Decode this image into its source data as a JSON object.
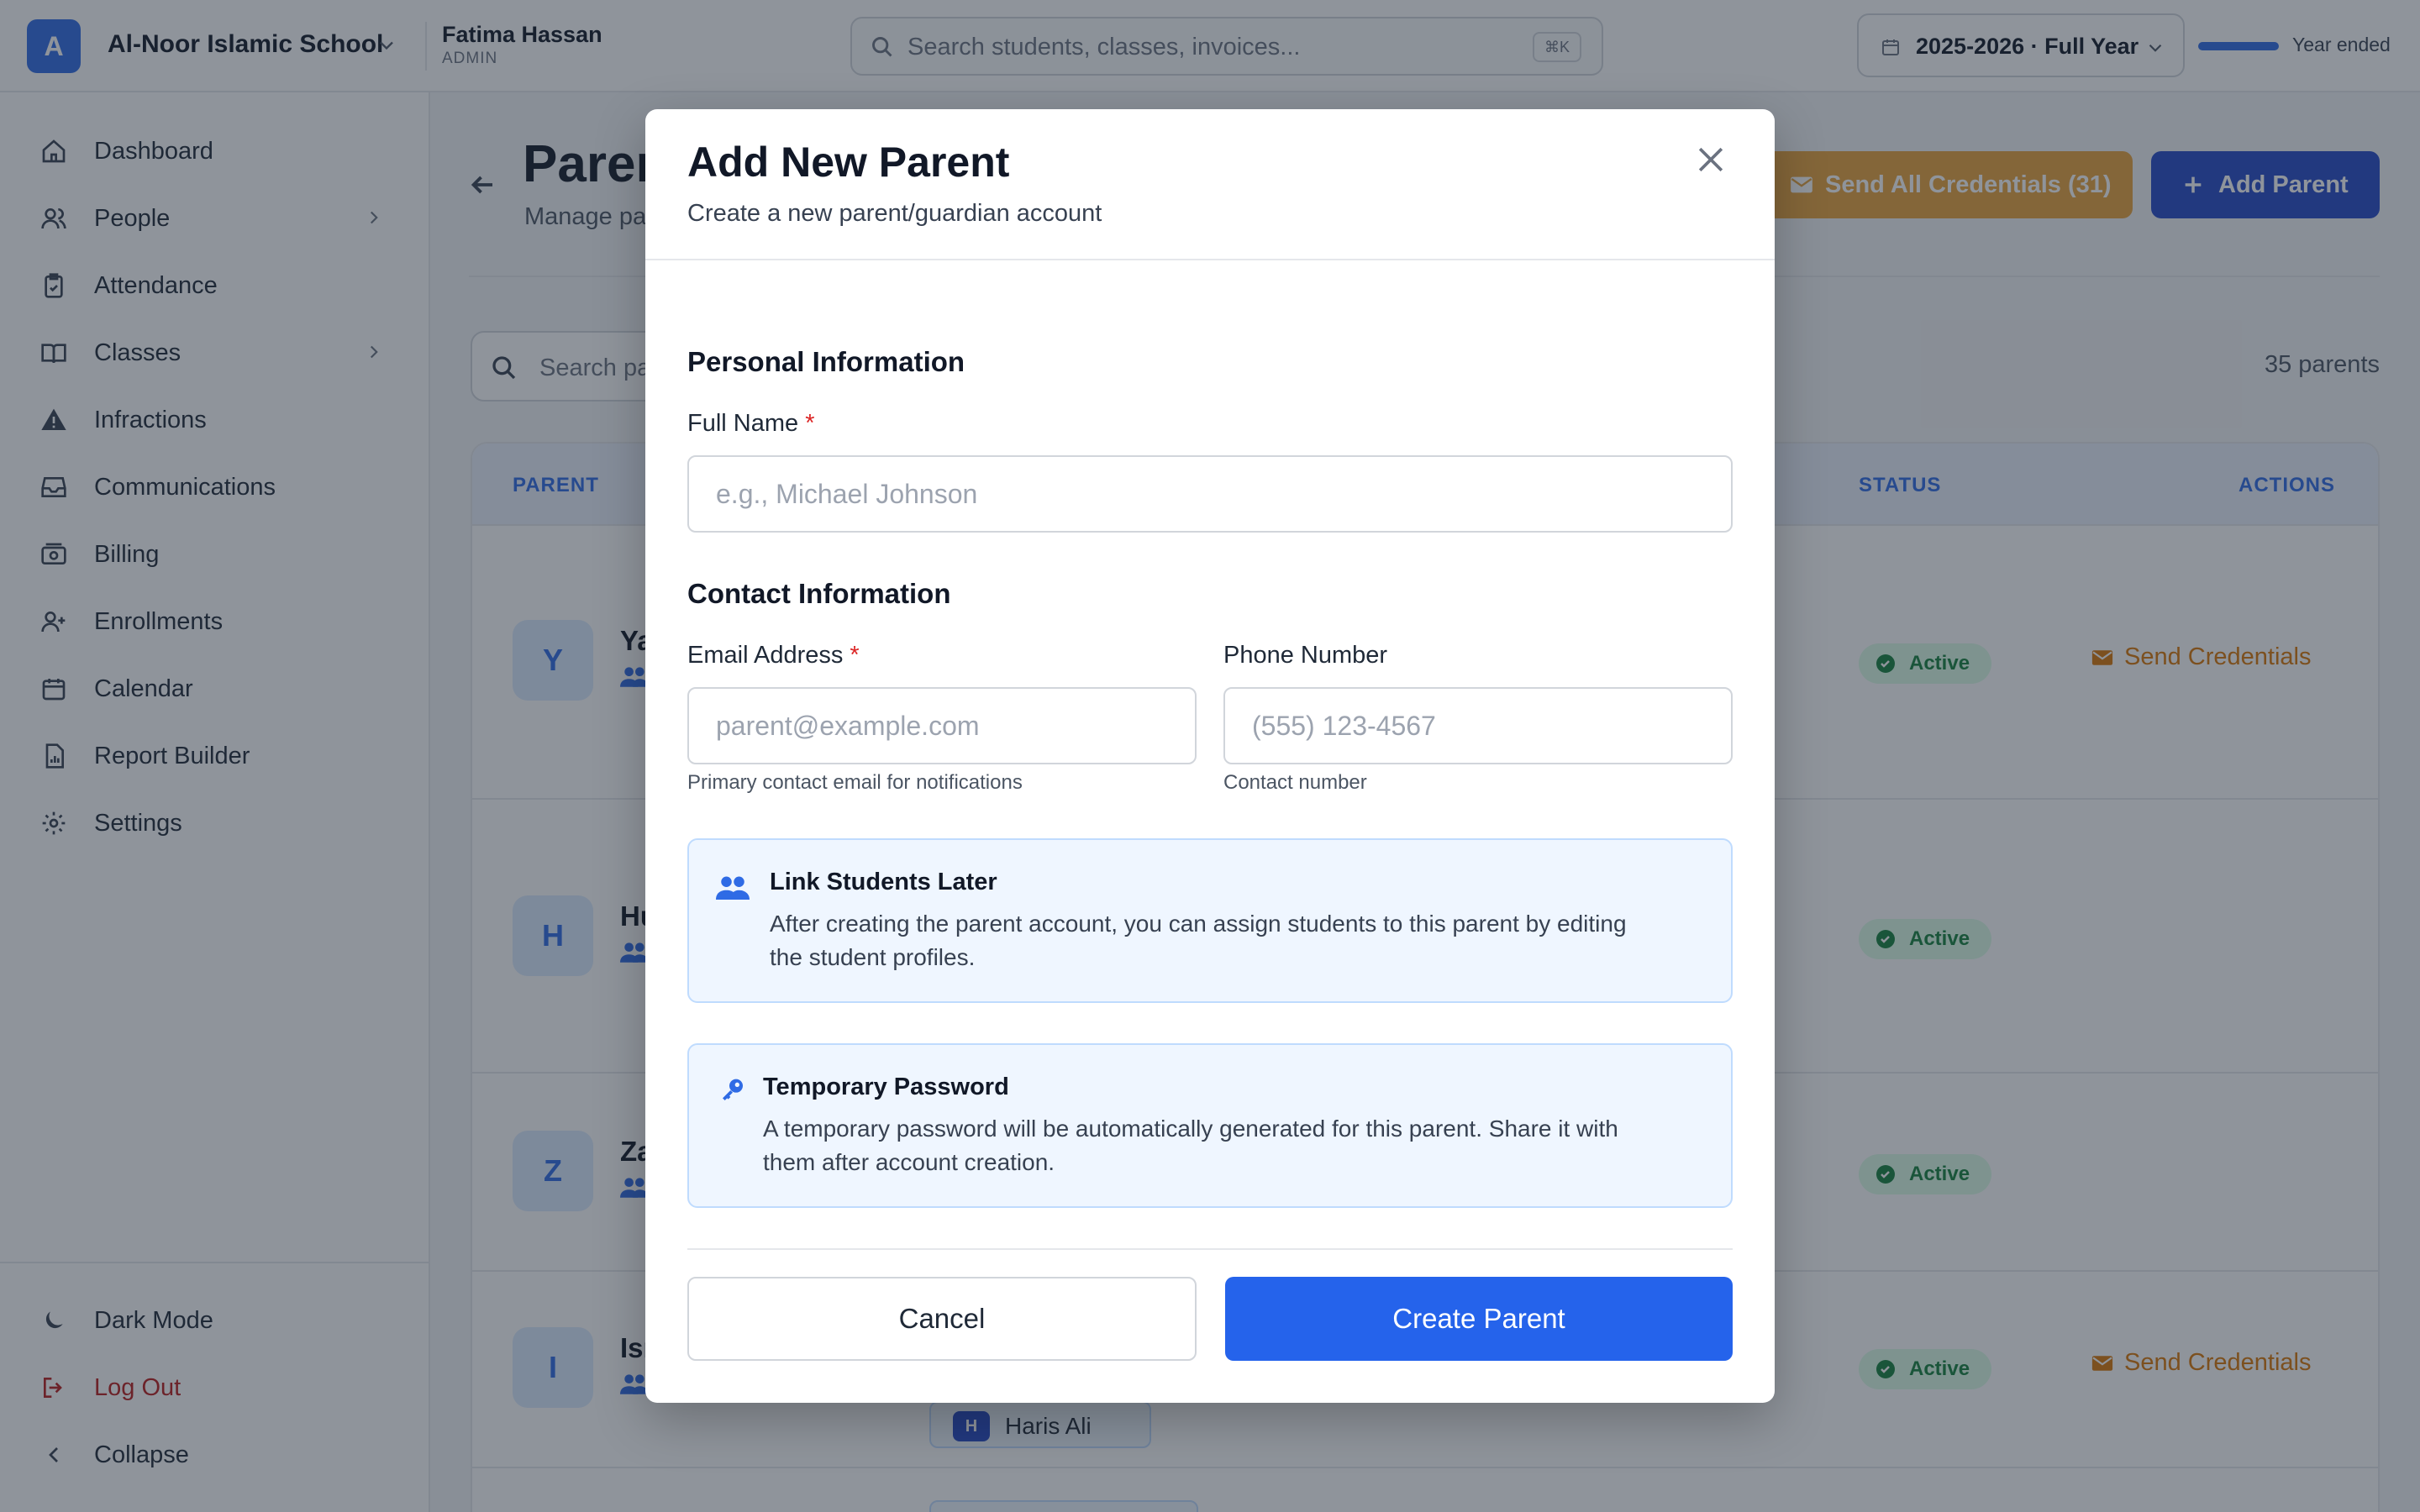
{
  "topbar": {
    "logo_letter": "A",
    "school_name": "Al-Noor Islamic School",
    "user_name": "Fatima Hassan",
    "user_role": "ADMIN",
    "search_placeholder": "Search students, classes, invoices...",
    "search_shortcut": "⌘K",
    "year_label": "2025-2026 · Full Year",
    "year_status": "Year ended",
    "year_progress": 1.0
  },
  "sidebar": {
    "items": [
      {
        "label": "Dashboard",
        "icon": "home-icon"
      },
      {
        "label": "People",
        "icon": "people-icon"
      },
      {
        "label": "Attendance",
        "icon": "clipboard-check-icon"
      },
      {
        "label": "Classes",
        "icon": "book-icon"
      },
      {
        "label": "Infractions",
        "icon": "warning-icon"
      },
      {
        "label": "Communications",
        "icon": "inbox-icon"
      },
      {
        "label": "Billing",
        "icon": "money-icon"
      },
      {
        "label": "Enrollments",
        "icon": "user-plus-icon"
      },
      {
        "label": "Calendar",
        "icon": "calendar-icon"
      },
      {
        "label": "Report Builder",
        "icon": "report-icon"
      },
      {
        "label": "Settings",
        "icon": "gear-icon"
      }
    ],
    "bottom": {
      "dark_mode": "Dark Mode",
      "log_out": "Log Out",
      "collapse": "Collapse"
    }
  },
  "page": {
    "title": "Paren",
    "subtitle": "Manage pa",
    "send_all_label": "Send All Credentials (31)",
    "add_parent_label": "Add Parent",
    "search_placeholder": "Search pa",
    "count": "35 parents",
    "columns": {
      "parent": "PARENT",
      "status": "STATUS",
      "actions": "ACTIONS"
    },
    "rows": [
      {
        "initial": "Y",
        "name": "Ya",
        "status": "Active",
        "action": "Send Credentials"
      },
      {
        "initial": "H",
        "name": "Hu",
        "status": "Active",
        "action": ""
      },
      {
        "initial": "Z",
        "name": "Za",
        "status": "Active",
        "action": ""
      },
      {
        "initial": "I",
        "name": "Isr",
        "status": "Active",
        "action": "Send Credentials",
        "chip_initial": "H",
        "chip_label": "Haris Ali"
      }
    ]
  },
  "modal": {
    "title": "Add New Parent",
    "subtitle": "Create a new parent/guardian account",
    "personal_heading": "Personal Information",
    "full_name_label": "Full Name",
    "full_name_placeholder": "e.g., Michael Johnson",
    "contact_heading": "Contact Information",
    "email_label": "Email Address",
    "email_placeholder": "parent@example.com",
    "email_help": "Primary contact email for notifications",
    "phone_label": "Phone Number",
    "phone_placeholder": "(555) 123-4567",
    "phone_help": "Contact number",
    "required_mark": "*",
    "link_title": "Link Students Later",
    "link_desc_1": "After creating the parent account, you can assign students to this parent by editing",
    "link_desc_2": "the student profiles.",
    "temp_title": "Temporary Password",
    "temp_desc_1": "A temporary password will be automatically generated for this parent. Share it with",
    "temp_desc_2": "them after account creation.",
    "cancel_label": "Cancel",
    "create_label": "Create Parent"
  },
  "colors": {
    "primary": "#2563eb",
    "brand": "#2f6be5",
    "warning": "#e8a23a",
    "danger": "#dc2626",
    "success": "#15803d"
  }
}
